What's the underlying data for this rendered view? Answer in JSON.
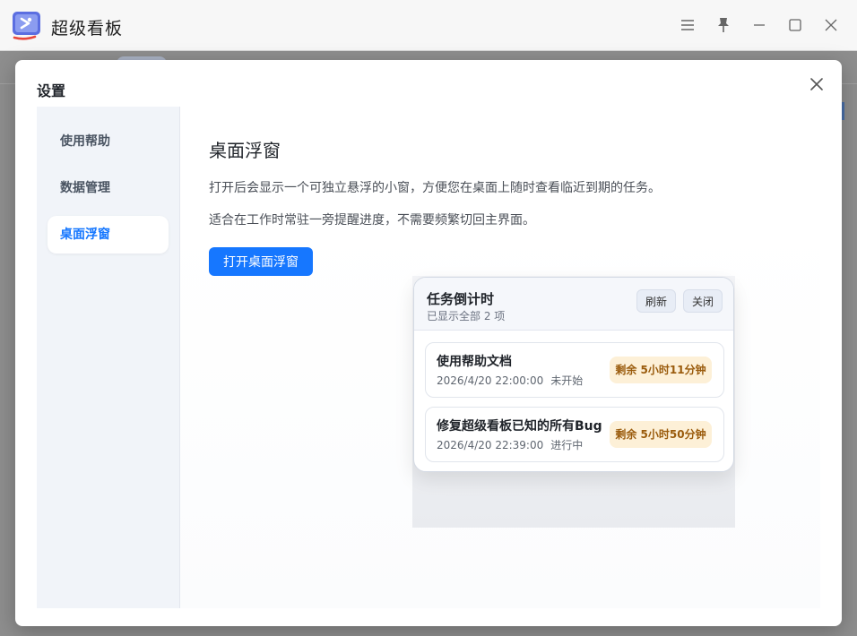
{
  "app": {
    "title": "超级看板"
  },
  "colors": {
    "accent": "#1677ff",
    "badge_bg": "#fdf0d7",
    "badge_text": "#9a5b0c"
  },
  "window_controls": [
    "menu-icon",
    "pin-icon",
    "minimize-icon",
    "maximize-icon",
    "close-icon"
  ],
  "dialog": {
    "title": "设置"
  },
  "sidebar": {
    "items": [
      {
        "label": "使用帮助",
        "active": false
      },
      {
        "label": "数据管理",
        "active": false
      },
      {
        "label": "桌面浮窗",
        "active": true
      }
    ]
  },
  "content": {
    "title": "桌面浮窗",
    "desc1": "打开后会显示一个可独立悬浮的小窗，方便您在桌面上随时查看临近到期的任务。",
    "desc2": "适合在工作时常驻一旁提醒进度，不需要频繁切回主界面。",
    "open_button": "打开桌面浮窗"
  },
  "floating": {
    "title": "任务倒计时",
    "subtitle": "已显示全部 2 项",
    "refresh_label": "刷新",
    "close_label": "关闭",
    "tasks": [
      {
        "name": "使用帮助文档",
        "date": "2026/4/20 22:00:00",
        "status": "未开始",
        "remaining": "剩余 5小时11分钟"
      },
      {
        "name": "修复超级看板已知的所有Bug",
        "date": "2026/4/20 22:39:00",
        "status": "进行中",
        "remaining": "剩余 5小时50分钟"
      }
    ]
  }
}
